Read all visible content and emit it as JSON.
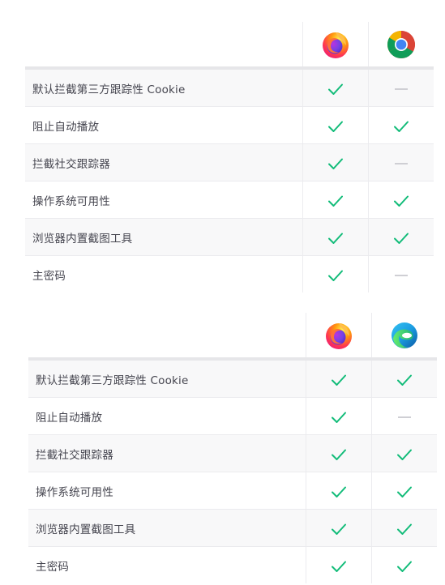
{
  "colors": {
    "check": "#12bc79",
    "dash": "#cfcfd4"
  },
  "table1": {
    "browsers": [
      {
        "name": "Firefox",
        "icon": "firefox-logo-icon"
      },
      {
        "name": "Chrome",
        "icon": "chrome-logo-icon"
      }
    ],
    "rows": [
      {
        "label": "默认拦截第三方跟踪性 Cookie",
        "firefox": "check",
        "other": "dash"
      },
      {
        "label": "阻止自动播放",
        "firefox": "check",
        "other": "check"
      },
      {
        "label": "拦截社交跟踪器",
        "firefox": "check",
        "other": "dash"
      },
      {
        "label": "操作系统可用性",
        "firefox": "check",
        "other": "check"
      },
      {
        "label": "浏览器内置截图工具",
        "firefox": "check",
        "other": "check"
      },
      {
        "label": "主密码",
        "firefox": "check",
        "other": "dash"
      }
    ]
  },
  "table2": {
    "browsers": [
      {
        "name": "Firefox",
        "icon": "firefox-logo-icon"
      },
      {
        "name": "Edge",
        "icon": "edge-logo-icon"
      }
    ],
    "rows": [
      {
        "label": "默认拦截第三方跟踪性 Cookie",
        "firefox": "check",
        "other": "check"
      },
      {
        "label": "阻止自动播放",
        "firefox": "check",
        "other": "dash"
      },
      {
        "label": "拦截社交跟踪器",
        "firefox": "check",
        "other": "check"
      },
      {
        "label": "操作系统可用性",
        "firefox": "check",
        "other": "check"
      },
      {
        "label": "浏览器内置截图工具",
        "firefox": "check",
        "other": "check"
      },
      {
        "label": "主密码",
        "firefox": "check",
        "other": "check"
      }
    ]
  }
}
